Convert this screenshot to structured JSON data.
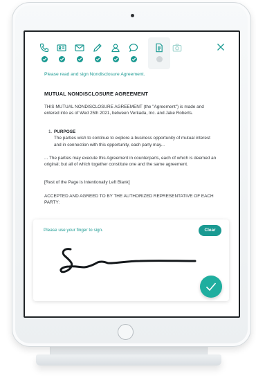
{
  "colors": {
    "accent": "#1a9a92",
    "confirm": "#1fae9f",
    "inactive_icon": "#1a9a92",
    "pending_dot": "#cfd5d8",
    "text": "#33373b"
  },
  "steps": [
    {
      "icon": "phone-icon",
      "status": "complete"
    },
    {
      "icon": "id-card-icon",
      "status": "complete"
    },
    {
      "icon": "envelope-icon",
      "status": "complete"
    },
    {
      "icon": "pencil-icon",
      "status": "complete"
    },
    {
      "icon": "user-icon",
      "status": "complete"
    },
    {
      "icon": "chat-bubble-icon",
      "status": "complete"
    },
    {
      "icon": "document-icon",
      "status": "current"
    },
    {
      "icon": "camera-icon",
      "status": "pending"
    }
  ],
  "document": {
    "instruction": "Please read and sign Nondisclosure Agreement.",
    "title": "MUTUAL NONDISCLOSURE AGREEMENT",
    "intro": "THIS MUTUAL NONDISCLOSURE AGREEMENT (the \"Agreement\") is made and entered into as of Wed 25th 2021, between Verkada, Inc. and Jake Roberts.",
    "section_number": "1.",
    "section_heading": "PURPOSE",
    "section_body": "The parties wish to continue to explore a business opportunity of mutual interest and in connection with this opportunity, each party may...",
    "counterparts": "... The parties may execute this Agreement in counterparts, each of which is deemed an original; but all of which together constitute one and the same agreement.",
    "blank_notice": "[Rest of the Page is Intentionally Left Blank]",
    "accepted": "ACCEPTED AND AGREED TO BY THE AUTHORIZED REPRESENTATIVE OF EACH PARTY:"
  },
  "signature": {
    "prompt": "Please use your finger to sign.",
    "clear_label": "Clear"
  }
}
